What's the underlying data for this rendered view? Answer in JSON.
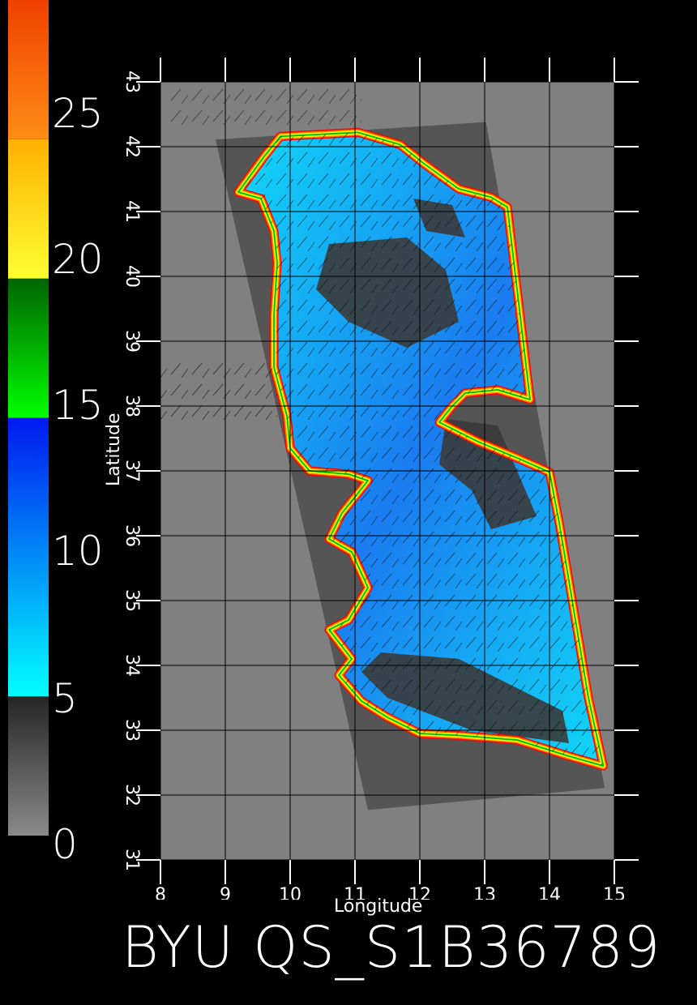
{
  "title": "BYU QS_S1B36789",
  "colorbar": {
    "labels": [
      "0",
      "5",
      "10",
      "15",
      "20",
      "25"
    ],
    "bands": [
      {
        "range": [
          0,
          5
        ],
        "from": "#8a8a8a",
        "to": "#252525"
      },
      {
        "range": [
          5,
          15
        ],
        "from": "#00ffff",
        "to": "#0018f0"
      },
      {
        "range": [
          15,
          20
        ],
        "from": "#00ff00",
        "to": "#006400"
      },
      {
        "range": [
          20,
          25
        ],
        "from": "#ffff30",
        "to": "#ffb000"
      },
      {
        "range": [
          25,
          30
        ],
        "from": "#ff8c14",
        "to": "#f04000"
      }
    ]
  },
  "map": {
    "xlabel": "Longitude",
    "ylabel": "Latitude",
    "lon_range": [
      8,
      15
    ],
    "lat_range": [
      31,
      43
    ],
    "lon_ticks": [
      8,
      9,
      10,
      11,
      12,
      13,
      14,
      15
    ],
    "lat_ticks": [
      31,
      32,
      33,
      34,
      35,
      36,
      37,
      38,
      39,
      40,
      41,
      42,
      43
    ],
    "colors": {
      "background": "#808080",
      "swath": "#555555",
      "sea_light": "#10d8f8",
      "sea_dark": "#1a7cf0",
      "land_dark": "#3a3a3a",
      "coast": [
        "#00c000",
        "#ffff00",
        "#ff8000",
        "#ff0000"
      ],
      "grid": "#000000",
      "ticks": "#ffffff"
    }
  }
}
